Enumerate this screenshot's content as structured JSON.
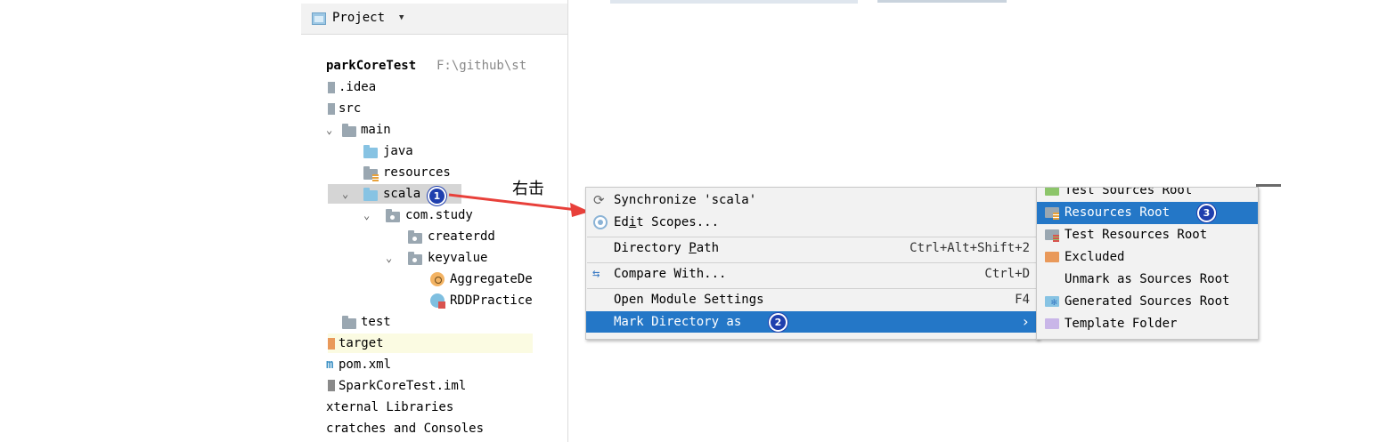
{
  "project_panel": {
    "title": "Project",
    "tree": {
      "root_name": "parkCoreTest",
      "root_path": "F:\\github\\st",
      "idea": ".idea",
      "src": "src",
      "main": "main",
      "java": "java",
      "resources": "resources",
      "scala": "scala",
      "com_study": "com.study",
      "createrdd": "createrdd",
      "keyvalue": "keyvalue",
      "aggregate": "AggregateDe",
      "rddpractice": "RDDPractice",
      "test": "test",
      "target": "target",
      "pom": "pom.xml",
      "iml": "SparkCoreTest.iml",
      "external_libraries": "xternal Libraries",
      "scratches": "cratches and Consoles"
    }
  },
  "annotations": {
    "right_click": "右击",
    "badge1": "1",
    "badge2": "2",
    "badge3": "3",
    "arrow_color": "#e8403a"
  },
  "context_menu": {
    "synchronize": "Synchronize 'scala'",
    "edit_scopes_pre": "Ed",
    "edit_scopes_u": "i",
    "edit_scopes_post": "t Scopes...",
    "directory_path_pre": "Directory ",
    "directory_path_u": "P",
    "directory_path_post": "ath",
    "directory_path_shortcut": "Ctrl+Alt+Shift+2",
    "compare_with": "Compare With...",
    "compare_with_shortcut": "Ctrl+D",
    "open_module_settings": "Open Module Settings",
    "open_module_settings_shortcut": "F4",
    "mark_directory_as": "Mark Directory as",
    "submenu_arrow": "›"
  },
  "submenu": {
    "test_sources_root": "Test Sources Root",
    "resources_root": "Resources Root",
    "test_resources_root": "Test Resources Root",
    "excluded": "Excluded",
    "unmark": "Unmark as Sources Root",
    "generated_sources_root": "Generated Sources Root",
    "template_folder": "Template Folder"
  },
  "colors": {
    "menu_highlight": "#2477c7",
    "tree_selection": "#d5d5d5",
    "badge": "#1f3fae"
  }
}
